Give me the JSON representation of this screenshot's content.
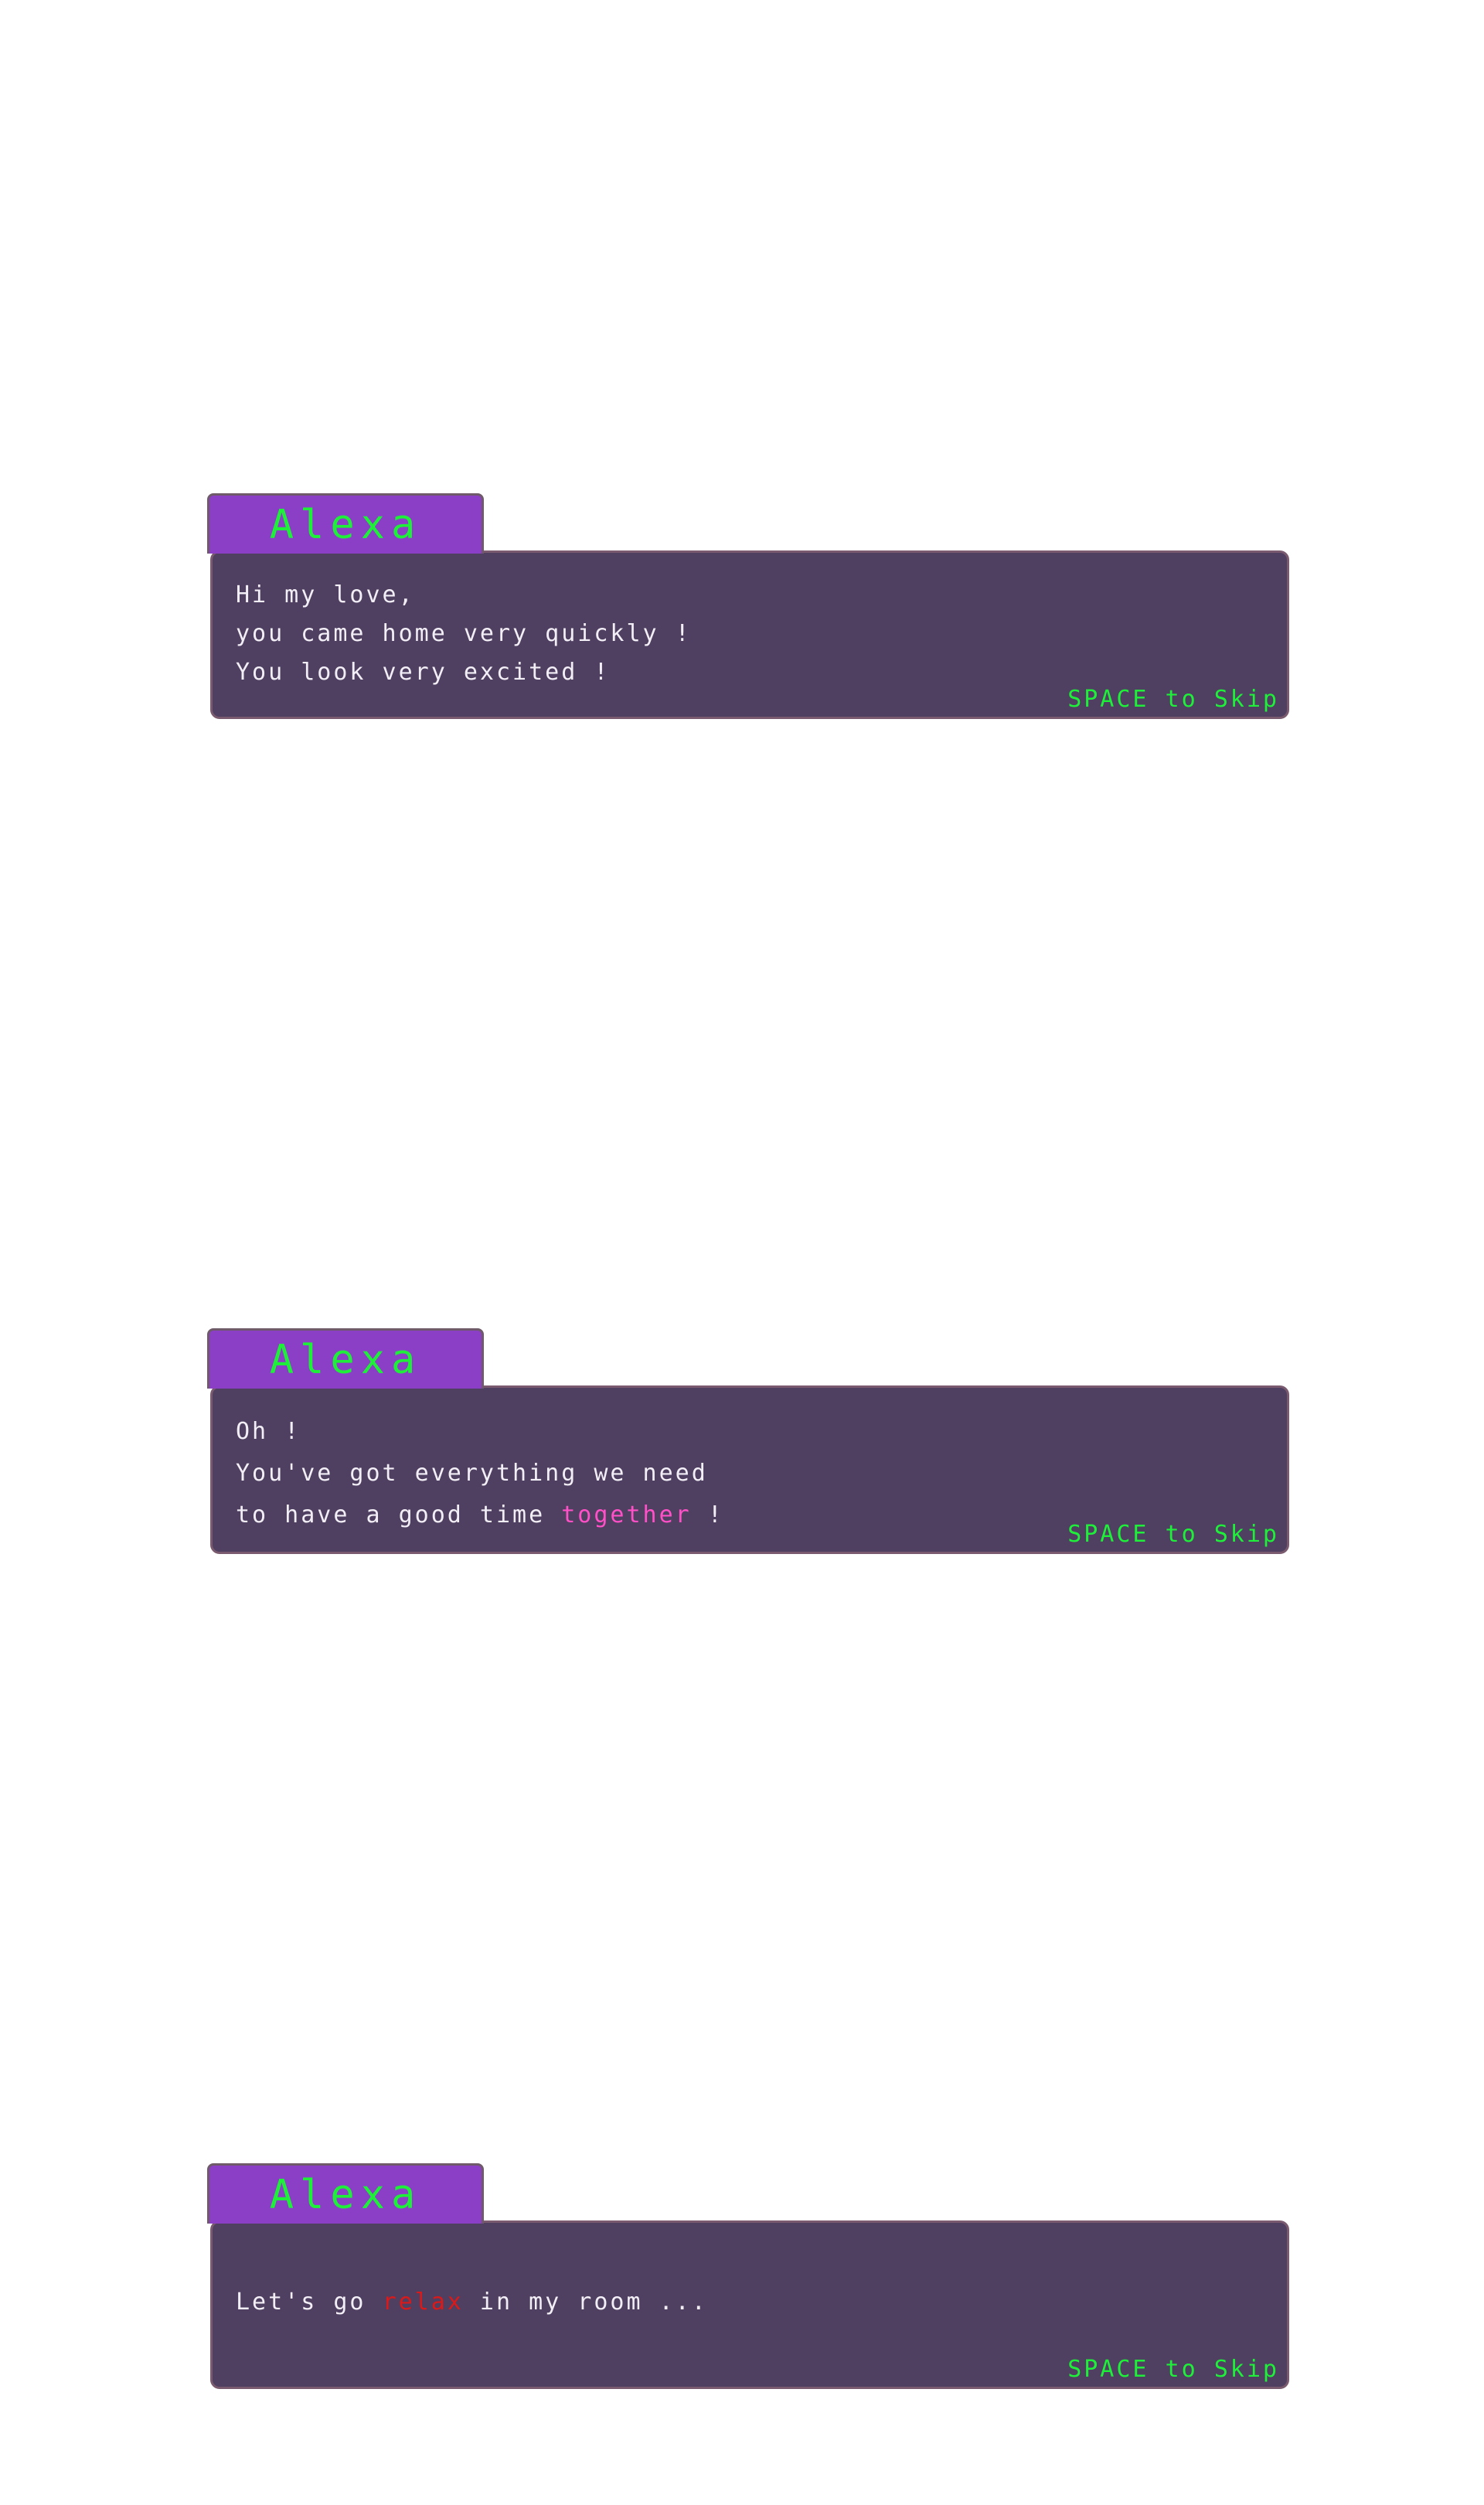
{
  "dialogues": [
    {
      "speaker": "Alexa",
      "lines": [
        "Hi my love,",
        "you came home very quickly !",
        "You look very excited !"
      ],
      "skip_hint": "SPACE to Skip"
    },
    {
      "speaker": "Alexa",
      "lines": [
        "Oh !",
        "You've got everything we need",
        "to have a good time"
      ],
      "line3_highlight": "together",
      "line3_end": " !",
      "skip_hint": "SPACE to Skip"
    },
    {
      "speaker": "Alexa",
      "line_start": "Let's go ",
      "line_highlight": "relax",
      "line_end": " in my room ...",
      "skip_hint": "SPACE to Skip"
    }
  ],
  "colors": {
    "name_tab": "#8b3fc6",
    "text_box": "#4f3f60",
    "accent_green": "#1ef03a",
    "highlight_pink": "#ff50c8",
    "highlight_red": "#d81a1a"
  }
}
